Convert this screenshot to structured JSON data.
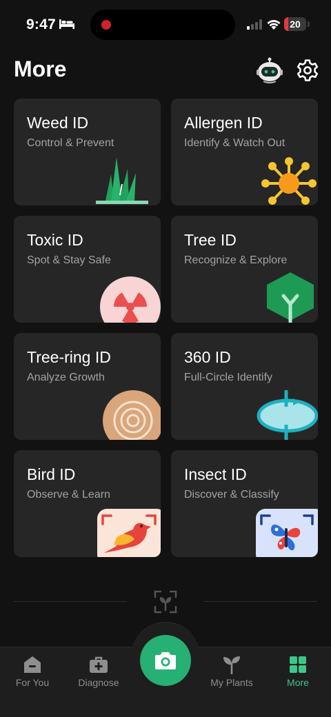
{
  "status_bar": {
    "time": "9:47",
    "battery_level": "20",
    "battery_fraction": 0.2,
    "icons": [
      "bed-icon",
      "signal-icon",
      "wifi-icon",
      "battery-icon"
    ]
  },
  "header": {
    "title": "More",
    "icons": [
      "robot-assistant-icon",
      "settings-gear-icon"
    ]
  },
  "cards": [
    {
      "title": "Weed ID",
      "subtitle": "Control & Prevent",
      "icon": "grass-icon"
    },
    {
      "title": "Allergen ID",
      "subtitle": "Identify & Watch Out",
      "icon": "pollen-icon"
    },
    {
      "title": "Toxic ID",
      "subtitle": "Spot & Stay Safe",
      "icon": "radiation-icon"
    },
    {
      "title": "Tree ID",
      "subtitle": "Recognize & Explore",
      "icon": "tree-icon"
    },
    {
      "title": "Tree-ring ID",
      "subtitle": "Analyze Growth",
      "icon": "tree-ring-icon"
    },
    {
      "title": "360 ID",
      "subtitle": "Full-Circle Identify",
      "icon": "rotate-360-icon"
    },
    {
      "title": "Bird ID",
      "subtitle": "Observe & Learn",
      "icon": "bird-icon"
    },
    {
      "title": "Insect ID",
      "subtitle": "Discover & Classify",
      "icon": "butterfly-icon"
    }
  ],
  "tabs": [
    {
      "label": "For You",
      "icon": "home-icon",
      "active": false
    },
    {
      "label": "Diagnose",
      "icon": "medical-kit-icon",
      "active": false
    },
    {
      "label": "My Plants",
      "icon": "sprout-icon",
      "active": false
    },
    {
      "label": "More",
      "icon": "grid-icon",
      "active": true
    }
  ],
  "colors": {
    "background": "#121212",
    "card": "#262626",
    "accent": "#27b074",
    "active_tab": "#3cc78a",
    "subtitle": "#a3a3a3"
  }
}
